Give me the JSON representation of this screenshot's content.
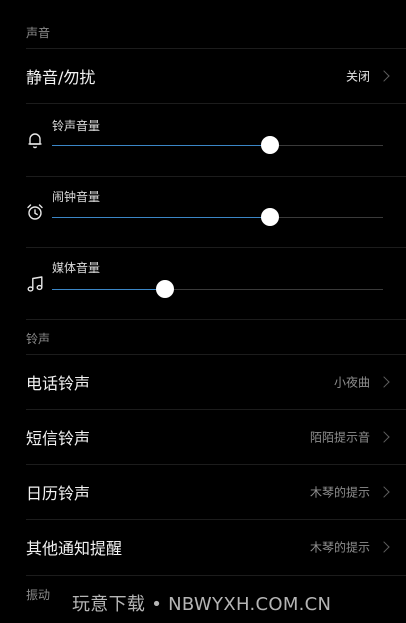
{
  "sections": {
    "sound_header": "声音",
    "ringtone_header": "铃声",
    "vibration_header": "振动"
  },
  "silent": {
    "label": "静音/勿扰",
    "value": "关闭"
  },
  "sliders": [
    {
      "label": "铃声音量",
      "icon": "bell-icon",
      "level": 0.66
    },
    {
      "label": "闹钟音量",
      "icon": "alarm-clock-icon",
      "level": 0.66
    },
    {
      "label": "媒体音量",
      "icon": "music-note-icon",
      "level": 0.34
    }
  ],
  "ringtones": [
    {
      "label": "电话铃声",
      "value": "小夜曲"
    },
    {
      "label": "短信铃声",
      "value": "陌陌提示音"
    },
    {
      "label": "日历铃声",
      "value": "木琴的提示"
    },
    {
      "label": "其他通知提醒",
      "value": "木琴的提示"
    }
  ],
  "watermark": "玩意下载 • NBWYXH.COM.CN",
  "colors": {
    "background": "#000000",
    "accent": "#3b86c6",
    "section_text": "#8a8a8a"
  }
}
